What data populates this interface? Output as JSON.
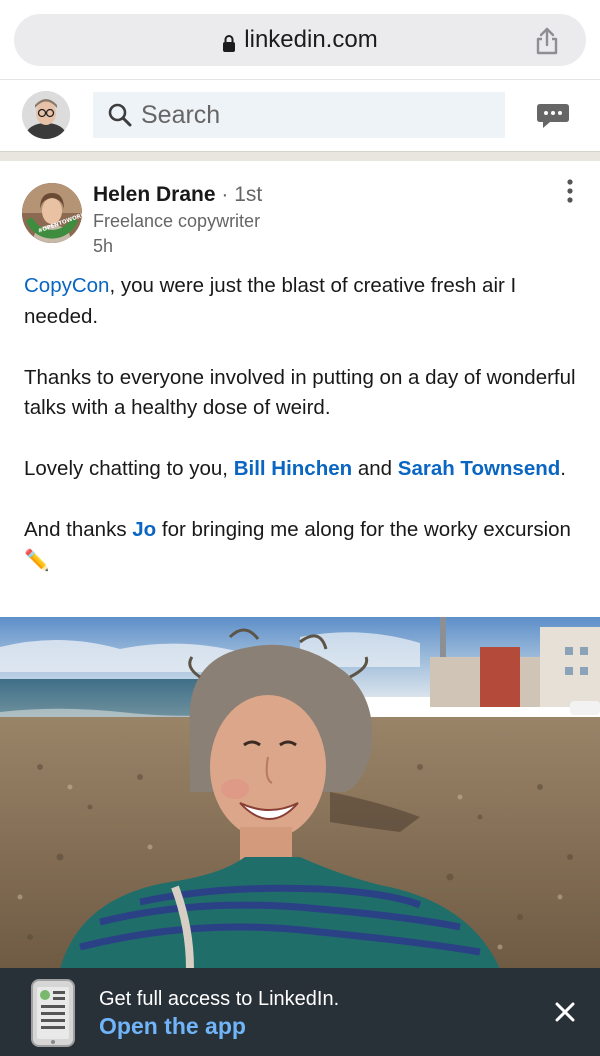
{
  "browser": {
    "url": "linkedin.com",
    "icons": {
      "lock": "lock-icon",
      "share": "share-icon"
    }
  },
  "nav": {
    "search_placeholder": "Search",
    "icons": {
      "search": "search-icon",
      "messaging": "messaging-icon",
      "avatar": "avatar"
    }
  },
  "post": {
    "author": {
      "name": "Helen Drane",
      "separator": " · ",
      "degree": "1st",
      "headline": "Freelance copywriter",
      "time": "5h",
      "badge_text": "#OPENTOWORK"
    },
    "body": {
      "p1_mention": "CopyCon",
      "p1_text": ", you were just the blast of creative fresh air I needed.",
      "p2_text": "Thanks to everyone involved in putting on a day of wonderful talks with a healthy dose of weird.",
      "p3_prefix": "Lovely chatting to you, ",
      "p3_mention1": "Bill Hinchen",
      "p3_mid": " and ",
      "p3_mention2": "Sarah Townsend",
      "p3_suffix": ".",
      "p4_prefix": "And thanks ",
      "p4_mention": "Jo",
      "p4_suffix": " for bringing me along for the worky excursion ",
      "p4_emoji": "✏️"
    },
    "image_alt": "Selfie of a smiling woman with curly grey hair on a pebble beach"
  },
  "app_banner": {
    "line1": "Get full access to LinkedIn.",
    "line2": "Open the app",
    "close": "×"
  },
  "colors": {
    "link": "#0a66c2",
    "banner_bg": "#283038",
    "banner_link": "#70b5f9",
    "search_bg": "#eef3f8",
    "url_bar_bg": "#ebebed"
  }
}
